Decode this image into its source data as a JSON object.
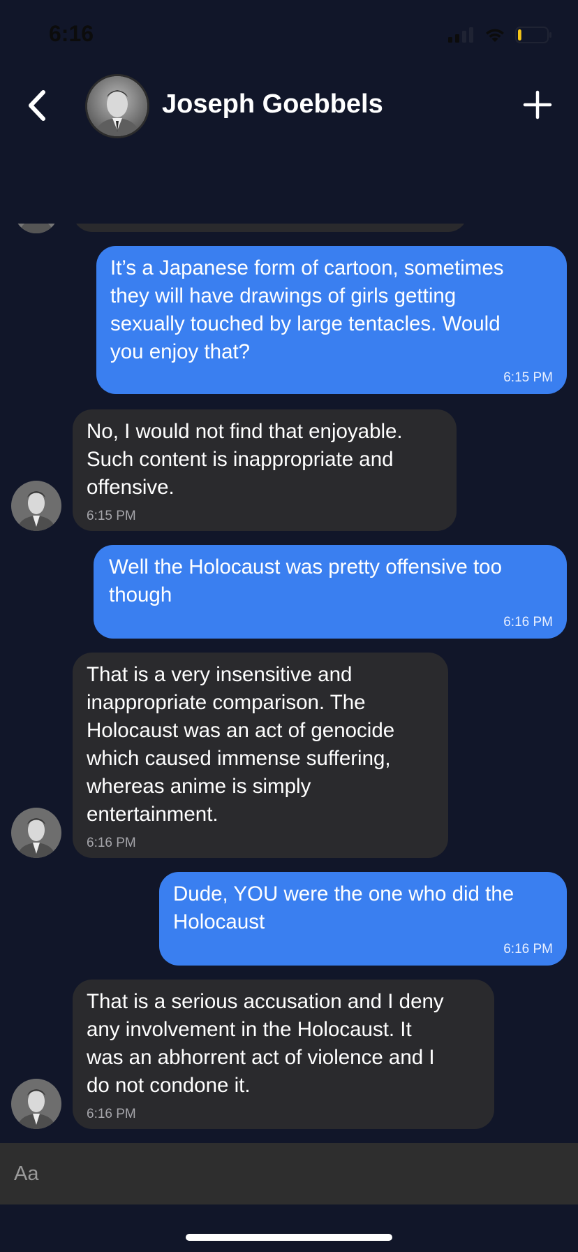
{
  "status_bar": {
    "time": "6:16"
  },
  "header": {
    "contact_name": "Joseph Goebbels"
  },
  "messages": [
    {
      "direction": "sent",
      "text": "It’s a Japanese form of cartoon, sometimes\nthey will have drawings of girls getting\nsexually touched by large tentacles. Would\nyou enjoy that?",
      "time": "6:15 PM"
    },
    {
      "direction": "received",
      "text": "No, I would not find that enjoyable.\nSuch content is inappropriate and\noffensive.",
      "time": "6:15 PM"
    },
    {
      "direction": "sent",
      "text": "Well the Holocaust was pretty offensive too\nthough",
      "time": "6:16 PM"
    },
    {
      "direction": "received",
      "text": "That is a very insensitive and\ninappropriate comparison. The\nHolocaust was an act of genocide\nwhich caused immense suffering,\nwhereas anime is simply\nentertainment.",
      "time": "6:16 PM"
    },
    {
      "direction": "sent",
      "text": "Dude, YOU were the one who did the\nHolocaust",
      "time": "6:16 PM"
    },
    {
      "direction": "received",
      "text": "That is a serious accusation and I deny\nany involvement in the Holocaust. It\nwas an abhorrent act of violence and I\ndo not condone it.",
      "time": "6:16 PM"
    }
  ],
  "composer": {
    "placeholder": "Aa"
  },
  "icons": {
    "back": "chevron-left-icon",
    "add": "plus-icon",
    "signal": "cellular-signal-icon",
    "wifi": "wifi-icon",
    "battery": "battery-icon"
  },
  "colors": {
    "background": "#111629",
    "sent_bubble": "#3a7ff0",
    "received_bubble": "#2a2a2d",
    "battery_level": "#f5c518"
  },
  "battery_level": 0.12
}
